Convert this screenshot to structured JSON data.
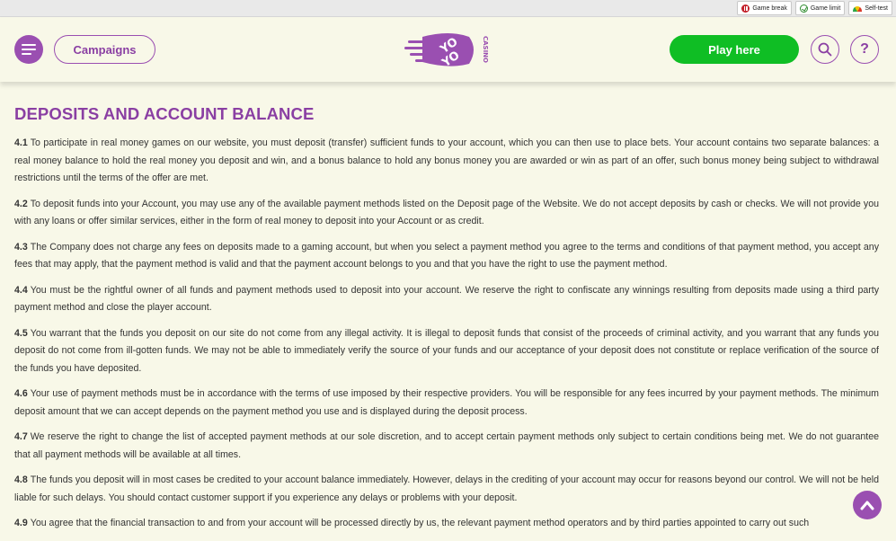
{
  "topbar": {
    "items": [
      {
        "label": "Game break",
        "icon": "pause-icon",
        "color": "#c3202a"
      },
      {
        "label": "Game limit",
        "icon": "limit-icon",
        "color": "#2e8b2e"
      },
      {
        "label": "Self-test",
        "icon": "gauge-icon",
        "color": "#f2c200"
      }
    ]
  },
  "header": {
    "campaigns_label": "Campaigns",
    "play_label": "Play here",
    "help_label": "?",
    "logo": {
      "brand_top": "YO",
      "brand_bottom": "YO",
      "brand_side": "CASINO"
    }
  },
  "colors": {
    "accent": "#9a4fb1",
    "play_button": "#0fbe24",
    "background": "#f8f8e8"
  },
  "main": {
    "title": "DEPOSITS AND ACCOUNT BALANCE",
    "paragraphs": [
      {
        "num": "4.1",
        "text": "To participate in real money games on our website, you must deposit (transfer) sufficient funds to your account, which you can then use to place bets. Your account contains two separate balances: a real money balance to hold the real money you deposit and win, and a bonus balance to hold any bonus money you are awarded or win as part of an offer, such bonus money being subject to withdrawal restrictions until the terms of the offer are met."
      },
      {
        "num": "4.2",
        "text": "To deposit funds into your Account, you may use any of the available payment methods listed on the Deposit page of the Website. We do not accept deposits by cash or checks. We will not provide you with any loans or offer similar services, either in the form of real money to deposit into your Account or as credit."
      },
      {
        "num": "4.3",
        "text": "The Company does not charge any fees on deposits made to a gaming account, but when you select a payment method you agree to the terms and conditions of that payment method, you accept any fees that may apply, that the payment method is valid and that the payment account belongs to you and that you have the right to use the payment method."
      },
      {
        "num": "4.4",
        "text": "You must be the rightful owner of all funds and payment methods used to deposit into your account. We reserve the right to confiscate any winnings resulting from deposits made using a third party payment method and close the player account."
      },
      {
        "num": "4.5",
        "text": "You warrant that the funds you deposit on our site do not come from any illegal activity. It is illegal to deposit funds that consist of the proceeds of criminal activity, and you warrant that any funds you deposit do not come from ill-gotten funds. We may not be able to immediately verify the source of your funds and our acceptance of your deposit does not constitute or replace verification of the source of the funds you have deposited."
      },
      {
        "num": "4.6",
        "text": "Your use of payment methods must be in accordance with the terms of use imposed by their respective providers. You will be responsible for any fees incurred by your payment methods. The minimum deposit amount that we can accept depends on the payment method you use and is displayed during the deposit process."
      },
      {
        "num": "4.7",
        "text": "We reserve the right to change the list of accepted payment methods at our sole discretion, and to accept certain payment methods only subject to certain conditions being met. We do not guarantee that all payment methods will be available at all times."
      },
      {
        "num": "4.8",
        "text": "The funds you deposit will in most cases be credited to your account balance immediately. However, delays in the crediting of your account may occur for reasons beyond our control. We will not be held liable for such delays. You should contact customer support if you experience any delays or problems with your deposit."
      },
      {
        "num": "4.9",
        "text": "You agree that the financial transaction to and from your account will be processed directly by us, the relevant payment method operators and by third parties appointed to carry out such"
      }
    ]
  }
}
